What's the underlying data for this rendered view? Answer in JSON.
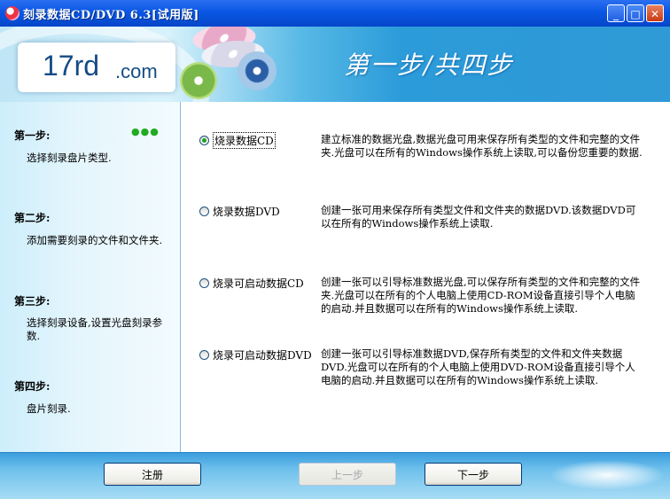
{
  "window": {
    "title": "刻录数据CD/DVD 6.3[试用版]",
    "controls": {
      "minimize": "_",
      "maximize": "□",
      "close": "✕"
    }
  },
  "banner": {
    "logo_main": "17rd",
    "logo_dot": ".com",
    "heading": "第一步/共四步"
  },
  "steps": [
    {
      "title": "第一步:",
      "desc": "选择刻录盘片类型."
    },
    {
      "title": "第二步:",
      "desc": "添加需要刻录的文件和文件夹."
    },
    {
      "title": "第三步:",
      "desc": "选择刻录设备,设置光盘刻录参数."
    },
    {
      "title": "第四步:",
      "desc": "盘片刻录."
    }
  ],
  "progress_dots": "●●●",
  "options": [
    {
      "label": "烧录数据CD",
      "checked": true,
      "desc": "建立标准的数据光盘,数据光盘可用来保存所有类型的文件和完整的文件夹.光盘可以在所有的Windows操作系统上读取,可以备份您重要的数据."
    },
    {
      "label": "烧录数据DVD",
      "checked": false,
      "desc": "创建一张可用来保存所有类型文件和文件夹的数据DVD.该数据DVD可以在所有的Windows操作系统上读取."
    },
    {
      "label": "烧录可启动数据CD",
      "checked": false,
      "desc": "创建一张可以引导标准数据光盘,可以保存所有类型的文件和完整的文件夹.光盘可以在所有的个人电脑上使用CD-ROM设备直接引导个人电脑的启动.并且数据可以在所有的Windows操作系统上读取."
    },
    {
      "label": "烧录可启动数据DVD",
      "checked": false,
      "desc": "创建一张可以引导标准数据DVD,保存所有类型的文件和文件夹数据DVD.光盘可以在所有的个人电脑上使用DVD-ROM设备直接引导个人电脑的启动.并且数据可以在所有的Windows操作系统上读取."
    }
  ],
  "footer": {
    "register_label": "注册",
    "prev_label": "上一步",
    "next_label": "下一步"
  },
  "colors": {
    "title_bar": "#0a57e4",
    "banner_blue": "#2b9bd9",
    "radio_dot": "#21a121"
  }
}
